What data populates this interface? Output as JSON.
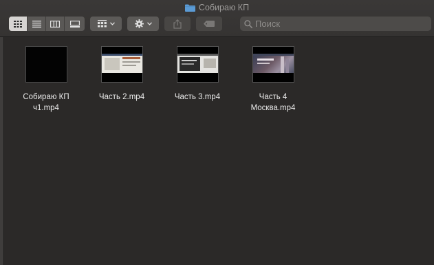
{
  "window": {
    "title": "Собираю КП"
  },
  "toolbar": {
    "view_modes": [
      {
        "name": "icon-view",
        "active": true
      },
      {
        "name": "list-view",
        "active": false
      },
      {
        "name": "column-view",
        "active": false
      },
      {
        "name": "gallery-view",
        "active": false
      }
    ],
    "search_placeholder": "Поиск"
  },
  "files": [
    {
      "name": "Собираю КП\nч1.mp4",
      "thumb": "black"
    },
    {
      "name": "Часть 2.mp4",
      "thumb": "web-light"
    },
    {
      "name": "Часть 3.mp4",
      "thumb": "web-dark-panel"
    },
    {
      "name": "Часть 4\nМосква.mp4",
      "thumb": "city-photo"
    }
  ],
  "colors": {
    "background": "#2b2928",
    "toolbar": "#3a3837",
    "folder": "#5b9bd5",
    "text": "#eaeaea"
  }
}
